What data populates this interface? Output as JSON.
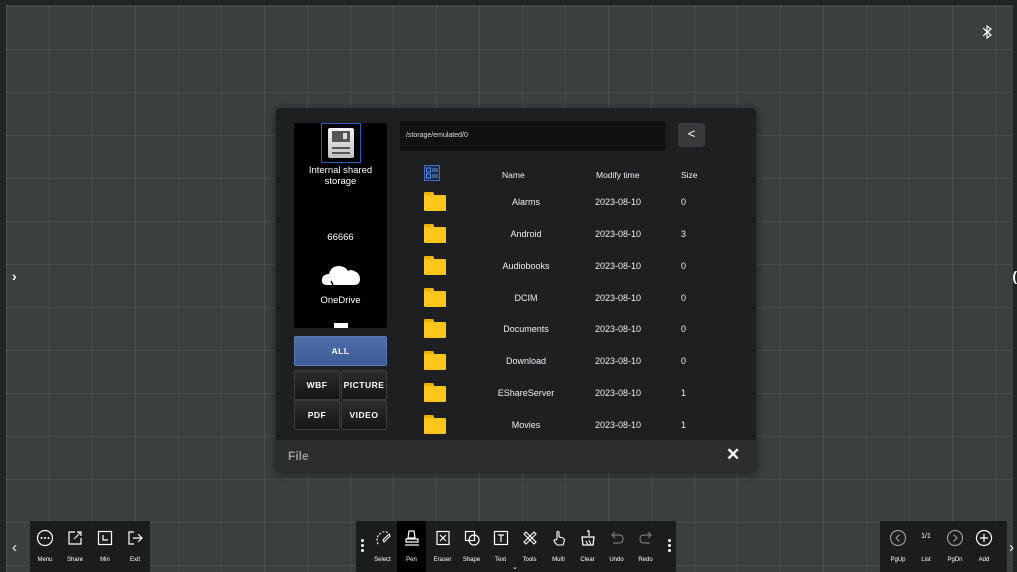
{
  "status": {
    "bluetooth_icon": "bluetooth-icon"
  },
  "file_dialog": {
    "path": "/storage/emulated/0",
    "back_label": "<",
    "footer_title": "File",
    "close_label": "✕",
    "sources": [
      {
        "label": "Internal shared storage",
        "icon": "storage-icon"
      },
      {
        "label": "66666",
        "icon": ""
      },
      {
        "label": "OneDrive",
        "icon": "cloud-icon"
      }
    ],
    "filters": {
      "all": "ALL",
      "wbf": "WBF",
      "picture": "PICTURE",
      "pdf": "PDF",
      "video": "VIDEO"
    },
    "columns": {
      "name": "Name",
      "modify_time": "Modify time",
      "size": "Size"
    },
    "files": [
      {
        "name": "Alarms",
        "time": "2023-08-10",
        "size": "0"
      },
      {
        "name": "Android",
        "time": "2023-08-10",
        "size": "3"
      },
      {
        "name": "Audiobooks",
        "time": "2023-08-10",
        "size": "0"
      },
      {
        "name": "DCIM",
        "time": "2023-08-10",
        "size": "0"
      },
      {
        "name": "Documents",
        "time": "2023-08-10",
        "size": "0"
      },
      {
        "name": "Download",
        "time": "2023-08-10",
        "size": "0"
      },
      {
        "name": "EShareServer",
        "time": "2023-08-10",
        "size": "1"
      },
      {
        "name": "Movies",
        "time": "2023-08-10",
        "size": "1"
      }
    ]
  },
  "toolbar_left": {
    "items": [
      {
        "label": "Menu",
        "icon": "menu-icon"
      },
      {
        "label": "Share",
        "icon": "share-icon"
      },
      {
        "label": "Min",
        "icon": "minimize-icon"
      },
      {
        "label": "Exit",
        "icon": "exit-icon"
      }
    ]
  },
  "toolbar_middle": {
    "active": "Pen",
    "items": [
      {
        "label": "Select",
        "icon": "select-icon"
      },
      {
        "label": "Pen",
        "icon": "pen-icon"
      },
      {
        "label": "Eraser",
        "icon": "eraser-icon"
      },
      {
        "label": "Shape",
        "icon": "shape-icon"
      },
      {
        "label": "Text",
        "icon": "text-icon"
      },
      {
        "label": "Tools",
        "icon": "tools-icon"
      },
      {
        "label": "Multi",
        "icon": "multi-touch-icon"
      },
      {
        "label": "Clear",
        "icon": "clear-icon"
      },
      {
        "label": "Undo",
        "icon": "undo-icon"
      },
      {
        "label": "Redo",
        "icon": "redo-icon"
      }
    ]
  },
  "toolbar_right": {
    "page_indicator": "1/1",
    "items": [
      {
        "label": "PgUp",
        "icon": "page-up-icon"
      },
      {
        "label": "List",
        "icon": ""
      },
      {
        "label": "PgDn",
        "icon": "page-down-icon"
      },
      {
        "label": "Add",
        "icon": "add-page-icon"
      }
    ]
  },
  "colors": {
    "accent": "#4f6ea8",
    "folder": "#ffc61a",
    "background": "#39403f"
  }
}
